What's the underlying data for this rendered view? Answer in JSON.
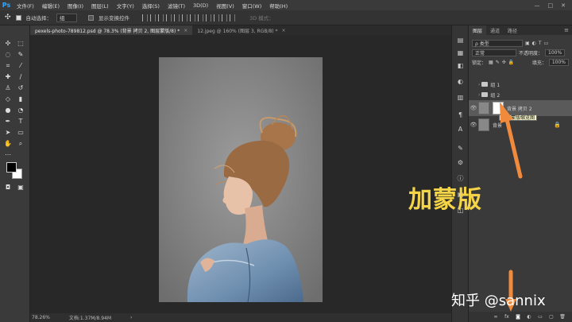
{
  "app": {
    "logo": "Ps"
  },
  "menu": [
    "文件(F)",
    "编辑(E)",
    "图像(I)",
    "图层(L)",
    "文字(Y)",
    "选择(S)",
    "滤镜(T)",
    "3D(D)",
    "视图(V)",
    "窗口(W)",
    "帮助(H)"
  ],
  "window_controls": {
    "minimize": "—",
    "restore": "□",
    "close": "✕"
  },
  "options_bar": {
    "auto_select_label": "自动选择：",
    "auto_select_value": "组",
    "show_transform_label": "显示变换控件",
    "mode_3d_label": "3D 模式："
  },
  "doc_tabs": [
    {
      "label": "pexels-photo-789812.psd @ 78.3% (背景 拷贝 2, 图层蒙版/8) *",
      "close": "×"
    },
    {
      "label": "12.jpeg @ 160% (图层 3, RGB/8) *",
      "close": "×"
    }
  ],
  "status": {
    "zoom": "78.26%",
    "doc_size": "文档:1.37M/8.94M"
  },
  "panel_tabs": [
    "图层",
    "通道",
    "路径"
  ],
  "layers_panel": {
    "kind_filter": "ρ 类型",
    "blend_mode": "正常",
    "opacity_label": "不透明度：",
    "opacity_value": "100%",
    "lock_label": "锁定：",
    "fill_label": "填充：",
    "fill_value": "100%",
    "layers": [
      {
        "name": "组 1",
        "type": "group",
        "visible": false
      },
      {
        "name": "组 2",
        "type": "group",
        "visible": false
      },
      {
        "name": "背景 拷贝 2",
        "type": "masked",
        "visible": true,
        "selected": true
      },
      {
        "name": "背景",
        "type": "background",
        "visible": true
      }
    ],
    "tooltip": "图层蒙版缩览图",
    "footer_icons": [
      "link-icon",
      "fx-icon",
      "mask-icon",
      "adjustment-icon",
      "folder-icon",
      "new-layer-icon",
      "trash-icon"
    ],
    "footer_labels": [
      "∞",
      "fx",
      "◙",
      "◐",
      "▭",
      "▢",
      "🗑"
    ]
  },
  "annotations": {
    "label": "加蒙版",
    "label_color": "#f5d547",
    "arrow_color": "#f08a3c",
    "watermark": "知乎 @sannix"
  }
}
